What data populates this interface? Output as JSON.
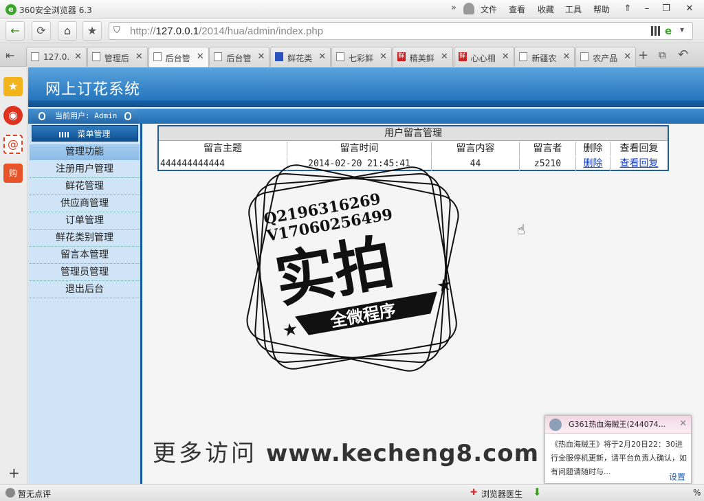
{
  "window": {
    "title": "360安全浏览器 6.3",
    "menus": [
      "文件",
      "查看",
      "收藏",
      "工具",
      "帮助"
    ]
  },
  "address": {
    "protocol": "http://",
    "host": "127.0.0.1",
    "path": "/2014/hua/admin/index.php"
  },
  "tabs": [
    {
      "label": "127.0.",
      "icon": "page"
    },
    {
      "label": "管理后",
      "icon": "page"
    },
    {
      "label": "后台管",
      "icon": "page",
      "active": true
    },
    {
      "label": "后台管",
      "icon": "page"
    },
    {
      "label": "鲜花类",
      "icon": "paw"
    },
    {
      "label": "七彩鲜",
      "icon": "page"
    },
    {
      "label": "精美鲜",
      "icon": "fresh"
    },
    {
      "label": "心心相",
      "icon": "fresh"
    },
    {
      "label": "新疆农",
      "icon": "page"
    },
    {
      "label": "农产品",
      "icon": "page"
    }
  ],
  "app": {
    "title": "网上订花系统",
    "current_user": "当前用户: Admin",
    "menu_header": "菜单管理",
    "section": "管理功能"
  },
  "nav_items": [
    "注册用户管理",
    "鲜花管理",
    "供应商管理",
    "订单管理",
    "鲜花类别管理",
    "留言本管理",
    "管理员管理",
    "退出后台"
  ],
  "table": {
    "caption": "用户留言管理",
    "headers": [
      "留言主题",
      "留言时间",
      "留言内容",
      "留言者",
      "删除",
      "查看回复"
    ],
    "rows": [
      {
        "subject": "444444444444",
        "time": "2014-02-20 21:45:41",
        "content": "44",
        "author": "z5210",
        "delete": "删除",
        "view": "查看回复"
      }
    ]
  },
  "stamp": {
    "line1": "Q2196316269",
    "line2": "V17060256499",
    "big": "实拍",
    "ribbon": "全微程序"
  },
  "watermark": {
    "cn": "更多访问",
    "url": "www.kecheng8.com"
  },
  "popup": {
    "title": "G361热血海贼王(244074...",
    "body": "《热血海贼王》将于2月20日22：30进行全服停机更新，请平台负责人确认，如有问题请随时与...",
    "settings": "设置"
  },
  "status": {
    "left": "暂无点评",
    "doctor": "浏览器医生",
    "percent": "%"
  }
}
